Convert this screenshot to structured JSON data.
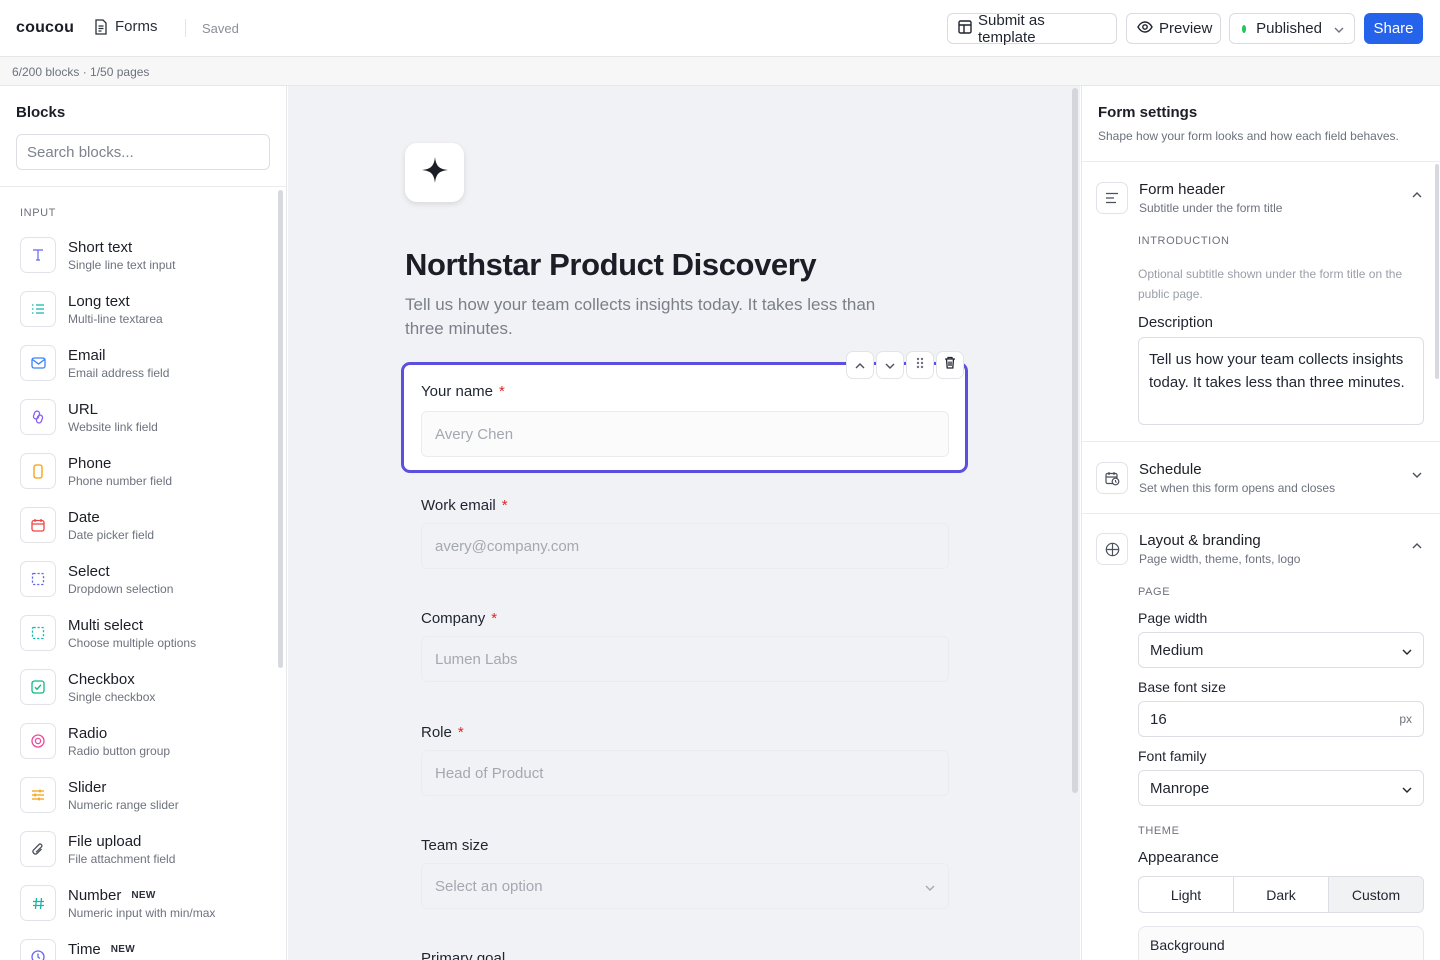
{
  "app": {
    "name": "coucou",
    "section": "Forms",
    "save_status": "Saved"
  },
  "toolbar": {
    "submit_template": "Submit as template",
    "preview": "Preview",
    "status": "Published",
    "share": "Share",
    "status_color": "#22c55e",
    "accent_color": "#2563eb"
  },
  "usage": "6/200 blocks · 1/50 pages",
  "blocks_panel": {
    "title": "Blocks",
    "search_placeholder": "Search blocks...",
    "section": "INPUT",
    "items": [
      {
        "name": "Short text",
        "desc": "Single line text input",
        "icon": "text-icon",
        "badge": ""
      },
      {
        "name": "Long text",
        "desc": "Multi-line textarea",
        "icon": "list-lines-icon",
        "badge": ""
      },
      {
        "name": "Email",
        "desc": "Email address field",
        "icon": "mail-icon",
        "badge": ""
      },
      {
        "name": "URL",
        "desc": "Website link field",
        "icon": "link-icon",
        "badge": ""
      },
      {
        "name": "Phone",
        "desc": "Phone number field",
        "icon": "phone-icon",
        "badge": ""
      },
      {
        "name": "Date",
        "desc": "Date picker field",
        "icon": "calendar-icon",
        "badge": ""
      },
      {
        "name": "Select",
        "desc": "Dropdown selection",
        "icon": "select-icon",
        "badge": ""
      },
      {
        "name": "Multi select",
        "desc": "Choose multiple options",
        "icon": "multi-select-icon",
        "badge": ""
      },
      {
        "name": "Checkbox",
        "desc": "Single checkbox",
        "icon": "checkbox-icon",
        "badge": ""
      },
      {
        "name": "Radio",
        "desc": "Radio button group",
        "icon": "radio-icon",
        "badge": ""
      },
      {
        "name": "Slider",
        "desc": "Numeric range slider",
        "icon": "sliders-icon",
        "badge": ""
      },
      {
        "name": "File upload",
        "desc": "File attachment field",
        "icon": "paperclip-icon",
        "badge": ""
      },
      {
        "name": "Number",
        "desc": "Numeric input with min/max",
        "icon": "hash-icon",
        "badge": "NEW"
      },
      {
        "name": "Time",
        "desc": "",
        "icon": "clock-icon",
        "badge": "NEW"
      }
    ]
  },
  "form": {
    "title": "Northstar Product Discovery",
    "description": "Tell us how your team collects insights today. It takes less than three minutes.",
    "fields": [
      {
        "label": "Your name",
        "required": "*",
        "placeholder": "Avery Chen"
      },
      {
        "label": "Work email",
        "required": "*",
        "placeholder": "avery@company.com"
      },
      {
        "label": "Company",
        "required": "*",
        "placeholder": "Lumen Labs"
      },
      {
        "label": "Role",
        "required": "*",
        "placeholder": "Head of Product"
      },
      {
        "label": "Team size",
        "required": "",
        "placeholder": "Select an option"
      },
      {
        "label": "Primary goal",
        "required": "",
        "placeholder": ""
      }
    ]
  },
  "settings": {
    "title": "Form settings",
    "subtitle": "Shape how your form looks and how each field behaves.",
    "header_section": {
      "title": "Form header",
      "subtitle": "Subtitle under the form title",
      "group_label": "INTRODUCTION",
      "help": "Optional subtitle shown under the form title on the public page.",
      "desc_label": "Description",
      "desc_value": "Tell us how your team collects insights today. It takes less than three minutes."
    },
    "schedule_section": {
      "title": "Schedule",
      "subtitle": "Set when this form opens and closes"
    },
    "layout_section": {
      "title": "Layout & branding",
      "subtitle": "Page width, theme, fonts, logo",
      "page_label": "PAGE",
      "page_width_label": "Page width",
      "page_width_value": "Medium",
      "font_size_label": "Base font size",
      "font_size_value": "16",
      "font_size_unit": "px",
      "font_family_label": "Font family",
      "font_family_value": "Manrope",
      "theme_label": "THEME",
      "appearance_label": "Appearance",
      "appearance_options": [
        "Light",
        "Dark",
        "Custom"
      ],
      "appearance_selected": "Custom",
      "background_label": "Background"
    }
  }
}
